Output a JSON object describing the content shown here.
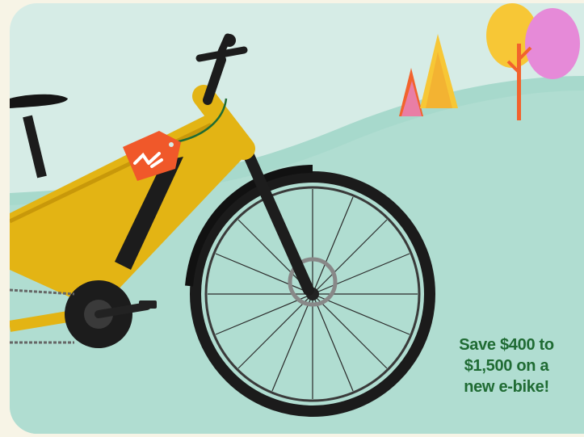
{
  "promo": {
    "lines": [
      "Save $400 to",
      "$1,500 on a",
      "new e-bike!"
    ]
  },
  "colors": {
    "sky": "#d6ece6",
    "hill": "#9fd6c8",
    "bike_frame": "#e3b414",
    "price_tag": "#f0582a",
    "promo_text": "#1f6b33",
    "tree_orange": "#f2632d",
    "tree_yellow": "#f7c736",
    "tree_pink": "#e68ad8"
  },
  "icons": {
    "price_tag": "brand-logo-tag-icon"
  }
}
